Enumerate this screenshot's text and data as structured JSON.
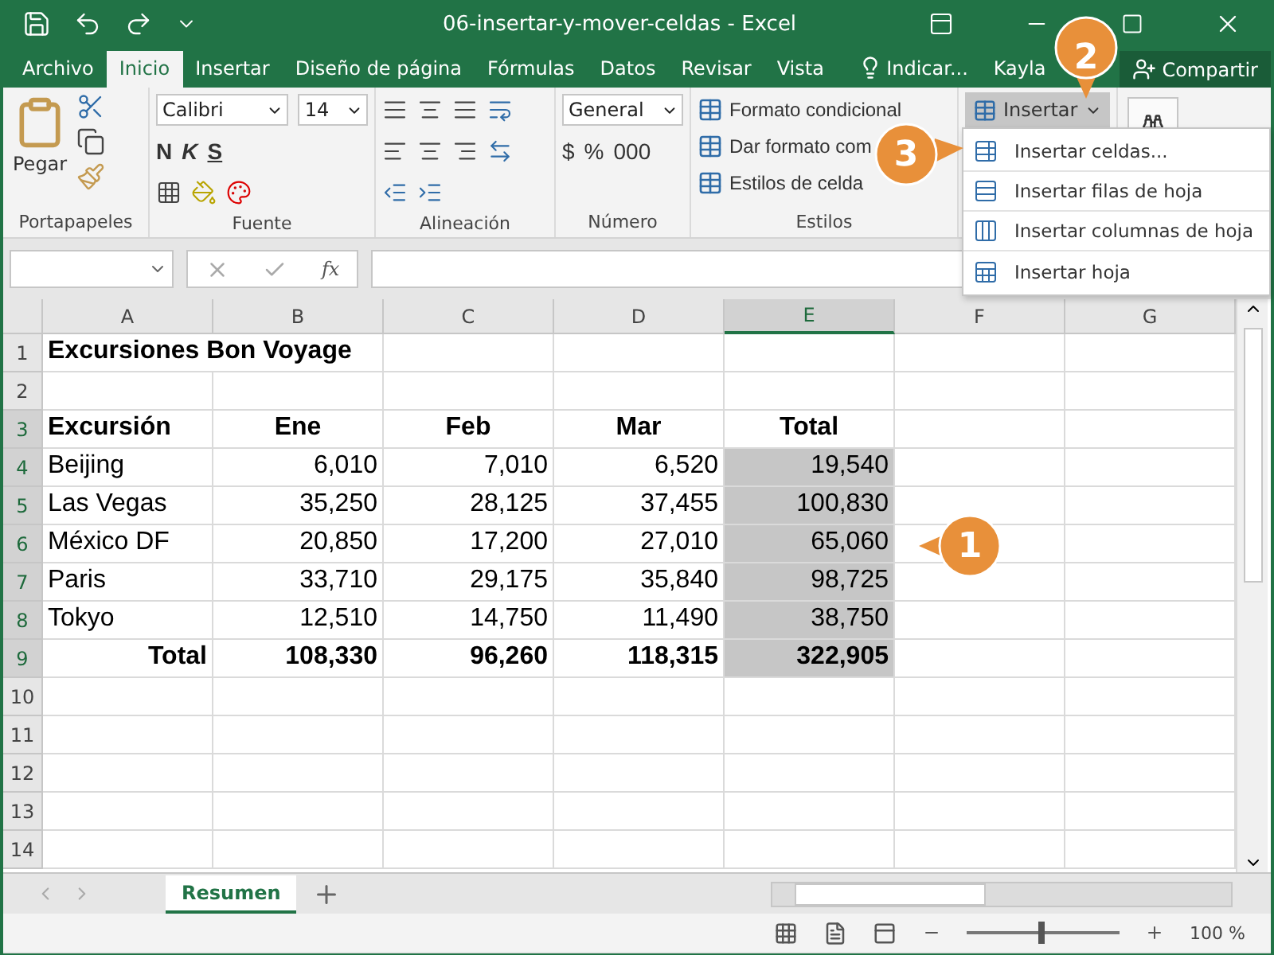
{
  "window": {
    "title": "06-insertar-y-mover-celdas  -  Excel"
  },
  "ribbon_tabs": [
    {
      "label": "Archivo",
      "selected": false
    },
    {
      "label": "Inicio",
      "selected": true
    },
    {
      "label": "Insertar",
      "selected": false
    },
    {
      "label": "Diseño de página",
      "selected": false
    },
    {
      "label": "Fórmulas",
      "selected": false
    },
    {
      "label": "Datos",
      "selected": false
    },
    {
      "label": "Revisar",
      "selected": false
    },
    {
      "label": "Vista",
      "selected": false
    }
  ],
  "tell_me": "Indicar...",
  "user": "Kayla",
  "share": "Compartir",
  "formula_bar": {
    "function_label": "fx"
  },
  "clipboard": {
    "paste": "Pegar",
    "label": "Portapapeles"
  },
  "font": {
    "name": "Calibri",
    "size": "14",
    "bold": "N",
    "italic": "K",
    "underline": "S",
    "label": "Fuente"
  },
  "alignment": {
    "label": "Alineación"
  },
  "number": {
    "format": "General",
    "currency": "$",
    "percent": "%",
    "thousands": "000",
    "label": "Número"
  },
  "styles": {
    "items": [
      "Formato condicional",
      "Dar formato com",
      "Estilos de celda"
    ],
    "label": "Estilos"
  },
  "cells": {
    "insert": "Insertar",
    "pressed": true
  },
  "insert_menu": [
    {
      "label": "Insertar celdas...",
      "kind": "cells"
    },
    {
      "label": "Insertar filas de hoja",
      "kind": "rows"
    },
    {
      "label": "Insertar columnas de hoja",
      "kind": "columns"
    },
    {
      "label": "Insertar hoja",
      "kind": "sheet"
    }
  ],
  "columns": [
    {
      "label": "A",
      "selected": false
    },
    {
      "label": "B",
      "selected": false
    },
    {
      "label": "C",
      "selected": false
    },
    {
      "label": "D",
      "selected": false
    },
    {
      "label": "E",
      "selected": true
    },
    {
      "label": "F",
      "selected": false
    },
    {
      "label": "G",
      "selected": false
    }
  ],
  "rows": [
    {
      "number": "1",
      "selected": false,
      "cells": [
        {
          "text": "Excursiones Bon Voyage",
          "bold": true,
          "kind": "text",
          "selected": false
        }
      ]
    },
    {
      "number": "2",
      "selected": false
    },
    {
      "number": "3",
      "selected": true,
      "cells": [
        {
          "text": "Excursión",
          "bold": true,
          "kind": "text",
          "selected": false
        },
        {
          "text": "Ene",
          "bold": true,
          "kind": "heading",
          "selected": false
        },
        {
          "text": "Feb",
          "bold": true,
          "kind": "heading",
          "selected": false
        },
        {
          "text": "Mar",
          "bold": true,
          "kind": "heading",
          "selected": false
        },
        {
          "text": "Total",
          "bold": true,
          "kind": "heading",
          "selected": false
        }
      ]
    },
    {
      "number": "4",
      "selected": true,
      "cells": [
        {
          "text": "Beijing",
          "bold": false,
          "kind": "text",
          "selected": false
        },
        {
          "text": "6,010",
          "bold": false,
          "kind": "number",
          "selected": false
        },
        {
          "text": "7,010",
          "bold": false,
          "kind": "number",
          "selected": false
        },
        {
          "text": "6,520",
          "bold": false,
          "kind": "number",
          "selected": false
        },
        {
          "text": "19,540",
          "bold": false,
          "kind": "number",
          "selected": true
        }
      ]
    },
    {
      "number": "5",
      "selected": true,
      "cells": [
        {
          "text": "Las Vegas",
          "bold": false,
          "kind": "text",
          "selected": false
        },
        {
          "text": "35,250",
          "bold": false,
          "kind": "number",
          "selected": false
        },
        {
          "text": "28,125",
          "bold": false,
          "kind": "number",
          "selected": false
        },
        {
          "text": "37,455",
          "bold": false,
          "kind": "number",
          "selected": false
        },
        {
          "text": "100,830",
          "bold": false,
          "kind": "number",
          "selected": true
        }
      ]
    },
    {
      "number": "6",
      "selected": true,
      "cells": [
        {
          "text": "México DF",
          "bold": false,
          "kind": "text",
          "selected": false
        },
        {
          "text": "20,850",
          "bold": false,
          "kind": "number",
          "selected": false
        },
        {
          "text": "17,200",
          "bold": false,
          "kind": "number",
          "selected": false
        },
        {
          "text": "27,010",
          "bold": false,
          "kind": "number",
          "selected": false
        },
        {
          "text": "65,060",
          "bold": false,
          "kind": "number",
          "selected": true
        }
      ]
    },
    {
      "number": "7",
      "selected": true,
      "cells": [
        {
          "text": "Paris",
          "bold": false,
          "kind": "text",
          "selected": false
        },
        {
          "text": "33,710",
          "bold": false,
          "kind": "number",
          "selected": false
        },
        {
          "text": "29,175",
          "bold": false,
          "kind": "number",
          "selected": false
        },
        {
          "text": "35,840",
          "bold": false,
          "kind": "number",
          "selected": false
        },
        {
          "text": "98,725",
          "bold": false,
          "kind": "number",
          "selected": true
        }
      ]
    },
    {
      "number": "8",
      "selected": true,
      "cells": [
        {
          "text": "Tokyo",
          "bold": false,
          "kind": "text",
          "selected": false
        },
        {
          "text": "12,510",
          "bold": false,
          "kind": "number",
          "selected": false
        },
        {
          "text": "14,750",
          "bold": false,
          "kind": "number",
          "selected": false
        },
        {
          "text": "11,490",
          "bold": false,
          "kind": "number",
          "selected": false
        },
        {
          "text": "38,750",
          "bold": false,
          "kind": "number",
          "selected": true
        }
      ]
    },
    {
      "number": "9",
      "selected": true,
      "cells": [
        {
          "text": "Total",
          "bold": true,
          "kind": "label",
          "selected": false
        },
        {
          "text": "108,330",
          "bold": true,
          "kind": "number",
          "selected": false
        },
        {
          "text": "96,260",
          "bold": true,
          "kind": "number",
          "selected": false
        },
        {
          "text": "118,315",
          "bold": true,
          "kind": "number",
          "selected": false
        },
        {
          "text": "322,905",
          "bold": true,
          "kind": "number",
          "selected": true
        }
      ]
    },
    {
      "number": "10",
      "selected": false
    },
    {
      "number": "11",
      "selected": false
    },
    {
      "number": "12",
      "selected": false
    },
    {
      "number": "13",
      "selected": false
    },
    {
      "number": "14",
      "selected": false
    }
  ],
  "sheet_tabs": [
    {
      "label": "Resumen",
      "selected": true
    }
  ],
  "zoom": {
    "level": 0.47,
    "reading": "100 %"
  },
  "callouts": [
    {
      "label": "1",
      "kind": "left"
    },
    {
      "label": "2",
      "kind": "down"
    },
    {
      "label": "3",
      "kind": "right"
    }
  ]
}
